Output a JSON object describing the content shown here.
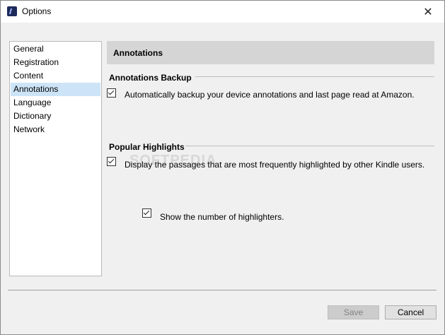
{
  "window": {
    "title": "Options",
    "close_glyph": "✕"
  },
  "sidebar": {
    "items": [
      {
        "label": "General",
        "selected": false
      },
      {
        "label": "Registration",
        "selected": false
      },
      {
        "label": "Content",
        "selected": false
      },
      {
        "label": "Annotations",
        "selected": true
      },
      {
        "label": "Language",
        "selected": false
      },
      {
        "label": "Dictionary",
        "selected": false
      },
      {
        "label": "Network",
        "selected": false
      }
    ]
  },
  "panel": {
    "header": "Annotations",
    "annotations_backup": {
      "title": "Annotations Backup",
      "auto_backup": {
        "label": "Automatically backup your device annotations and last page read at Amazon.",
        "checked": true
      }
    },
    "popular_highlights": {
      "title": "Popular Highlights",
      "display_passages": {
        "label": "Display the passages that are most frequently highlighted by other Kindle users.",
        "checked": true
      },
      "show_count": {
        "label": "Show the number of highlighters.",
        "checked": true
      }
    }
  },
  "watermark": "SOFTPEDIA",
  "buttons": {
    "save": "Save",
    "cancel": "Cancel",
    "save_enabled": false
  },
  "colors": {
    "selection": "#cde4f7",
    "header_bg": "#d5d5d5",
    "window_bg": "#f0f0f0"
  }
}
